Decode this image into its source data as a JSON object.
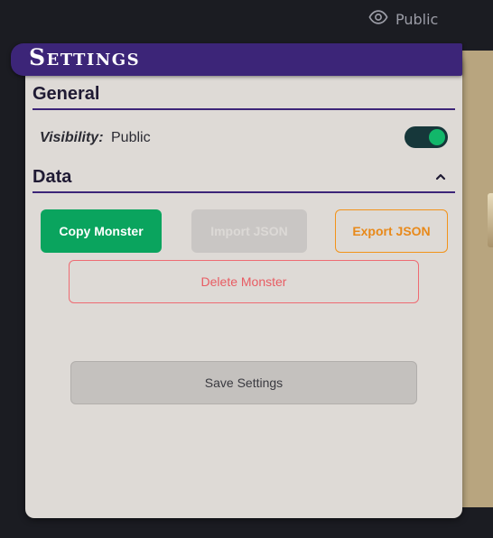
{
  "topbar": {
    "visibility_text": "Public",
    "visibility_icon": "eye-icon"
  },
  "settings": {
    "title": "Settings",
    "general": {
      "heading": "General",
      "visibility_label": "Visibility:",
      "visibility_value": "Public",
      "toggle_on": true
    },
    "data": {
      "heading": "Data",
      "collapse_icon": "chevron-up-icon",
      "copy_label": "Copy Monster",
      "import_label": "Import JSON",
      "export_label": "Export JSON",
      "delete_label": "Delete Monster"
    },
    "save_label": "Save Settings"
  },
  "colors": {
    "header_purple": "#3c2578",
    "primary_green": "#0aa45e",
    "export_orange": "#f2931a",
    "delete_red": "#ee6b72",
    "toggle_track": "#16373a",
    "toggle_knob": "#12b76a"
  }
}
